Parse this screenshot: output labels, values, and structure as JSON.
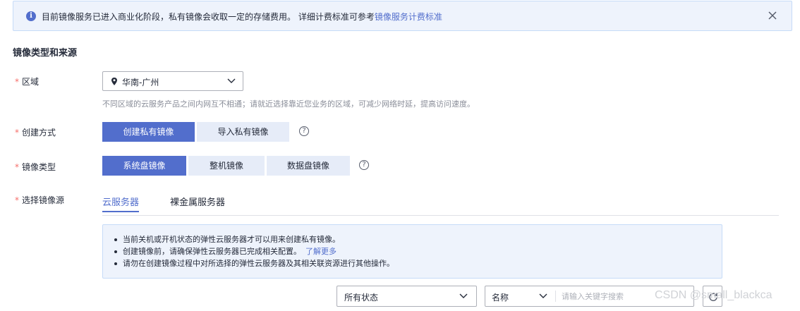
{
  "notice": {
    "text": "目前镜像服务已进入商业化阶段，私有镜像会收取一定的存储费用。 详细计费标准可参考",
    "link": "镜像服务计费标准",
    "info_icon": "i"
  },
  "section_title": "镜像类型和来源",
  "region": {
    "label": "区域",
    "value": "华南-广州",
    "hint": "不同区域的云服务产品之间内网互不相通；请就近选择靠近您业务的区域，可减少网络时延，提高访问速度。"
  },
  "create_method": {
    "label": "创建方式",
    "options": [
      "创建私有镜像",
      "导入私有镜像"
    ],
    "selected": "创建私有镜像"
  },
  "image_type": {
    "label": "镜像类型",
    "options": [
      "系统盘镜像",
      "整机镜像",
      "数据盘镜像"
    ],
    "selected": "系统盘镜像"
  },
  "image_source": {
    "label": "选择镜像源",
    "tabs": [
      "云服务器",
      "裸金属服务器"
    ],
    "selected_tab": "云服务器"
  },
  "tips": {
    "items": [
      "当前关机或开机状态的弹性云服务器才可以用来创建私有镜像。",
      "创建镜像前，请确保弹性云服务器已完成相关配置。",
      "请勿在创建镜像过程中对所选择的弹性云服务器及其相关联资源进行其他操作。"
    ],
    "learn_more": "了解更多"
  },
  "filter": {
    "status_value": "所有状态",
    "field_value": "名称",
    "search_placeholder": "请输入关键字搜索"
  },
  "help_icon_glyph": "?",
  "required_mark": "*",
  "watermark": "CSDN @small_blackca",
  "colors": {
    "accent": "#526ecc",
    "notice_bg": "#eef3fc",
    "segment_inactive_bg": "#e6ecf8",
    "required": "#f66f6a"
  }
}
